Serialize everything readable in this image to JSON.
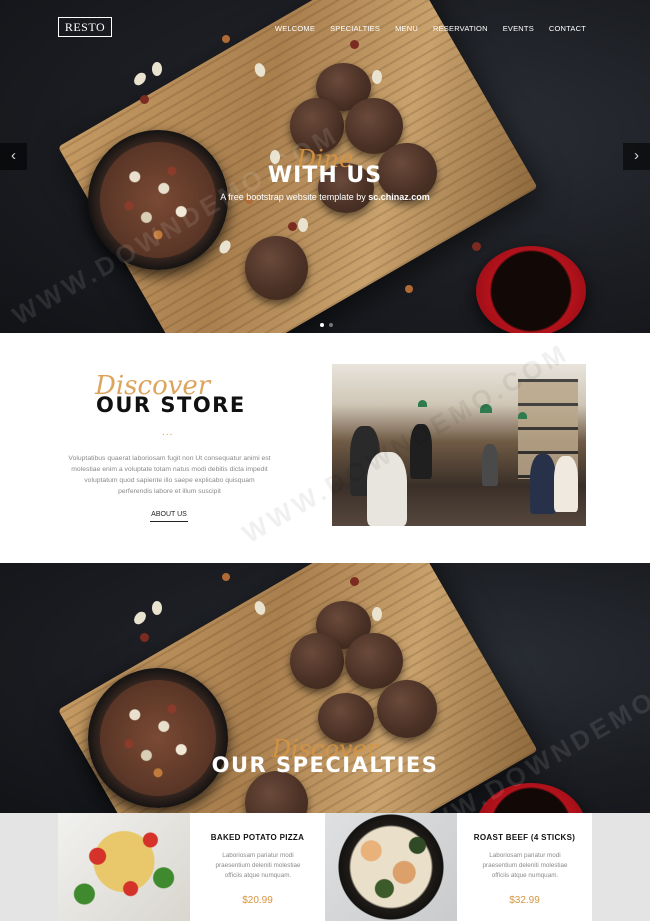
{
  "brand": {
    "logo": "RESTO"
  },
  "nav": {
    "items": [
      "WELCOME",
      "SPECIALTIES",
      "MENU",
      "RESERVATION",
      "EVENTS",
      "CONTACT"
    ]
  },
  "hero": {
    "script_text": "Dine",
    "title": "WITH US",
    "subtitle_prefix": "A free bootstrap website template by ",
    "subtitle_link": "sc.chinaz.com",
    "prev_icon": "chevron-left-icon",
    "next_icon": "chevron-right-icon",
    "slides_total": 2,
    "active_slide": 1
  },
  "store": {
    "script_text": "Discover",
    "title": "OUR STORE",
    "separator": "...",
    "paragraph": "Voluptatibus quaerat laboriosam fugit non Ut consequatur animi est molestiae enim a voluptate totam natus modi debitis dicta impedit voluptatum quod sapiente illo saepe explicabo quisquam perferendis labore et illum suscipit",
    "button_label": "ABOUT US"
  },
  "specialties": {
    "script_text": "Discover",
    "title": "OUR SPECIALTIES"
  },
  "menu_items": [
    {
      "name": "BAKED POTATO PIZZA",
      "description": "Laboriosam pariatur modi praesentium deleniti molestiae officiis atque numquam.",
      "price": "$20.99",
      "image_icon": "pasta-salad-photo"
    },
    {
      "name": "ROAST BEEF (4 STICKS)",
      "description": "Laboriosam pariatur modi praesentium deleniti molestiae officiis atque numquam.",
      "price": "$32.99",
      "image_icon": "roast-beef-photo"
    }
  ],
  "watermark": "WWW.DOWNDEMO.COM",
  "colors": {
    "accent": "#d89540",
    "dark_bg": "#1b1d22",
    "text_dark": "#111111",
    "text_muted": "#8a8a8a",
    "menu_bg": "#e4e4e4"
  }
}
